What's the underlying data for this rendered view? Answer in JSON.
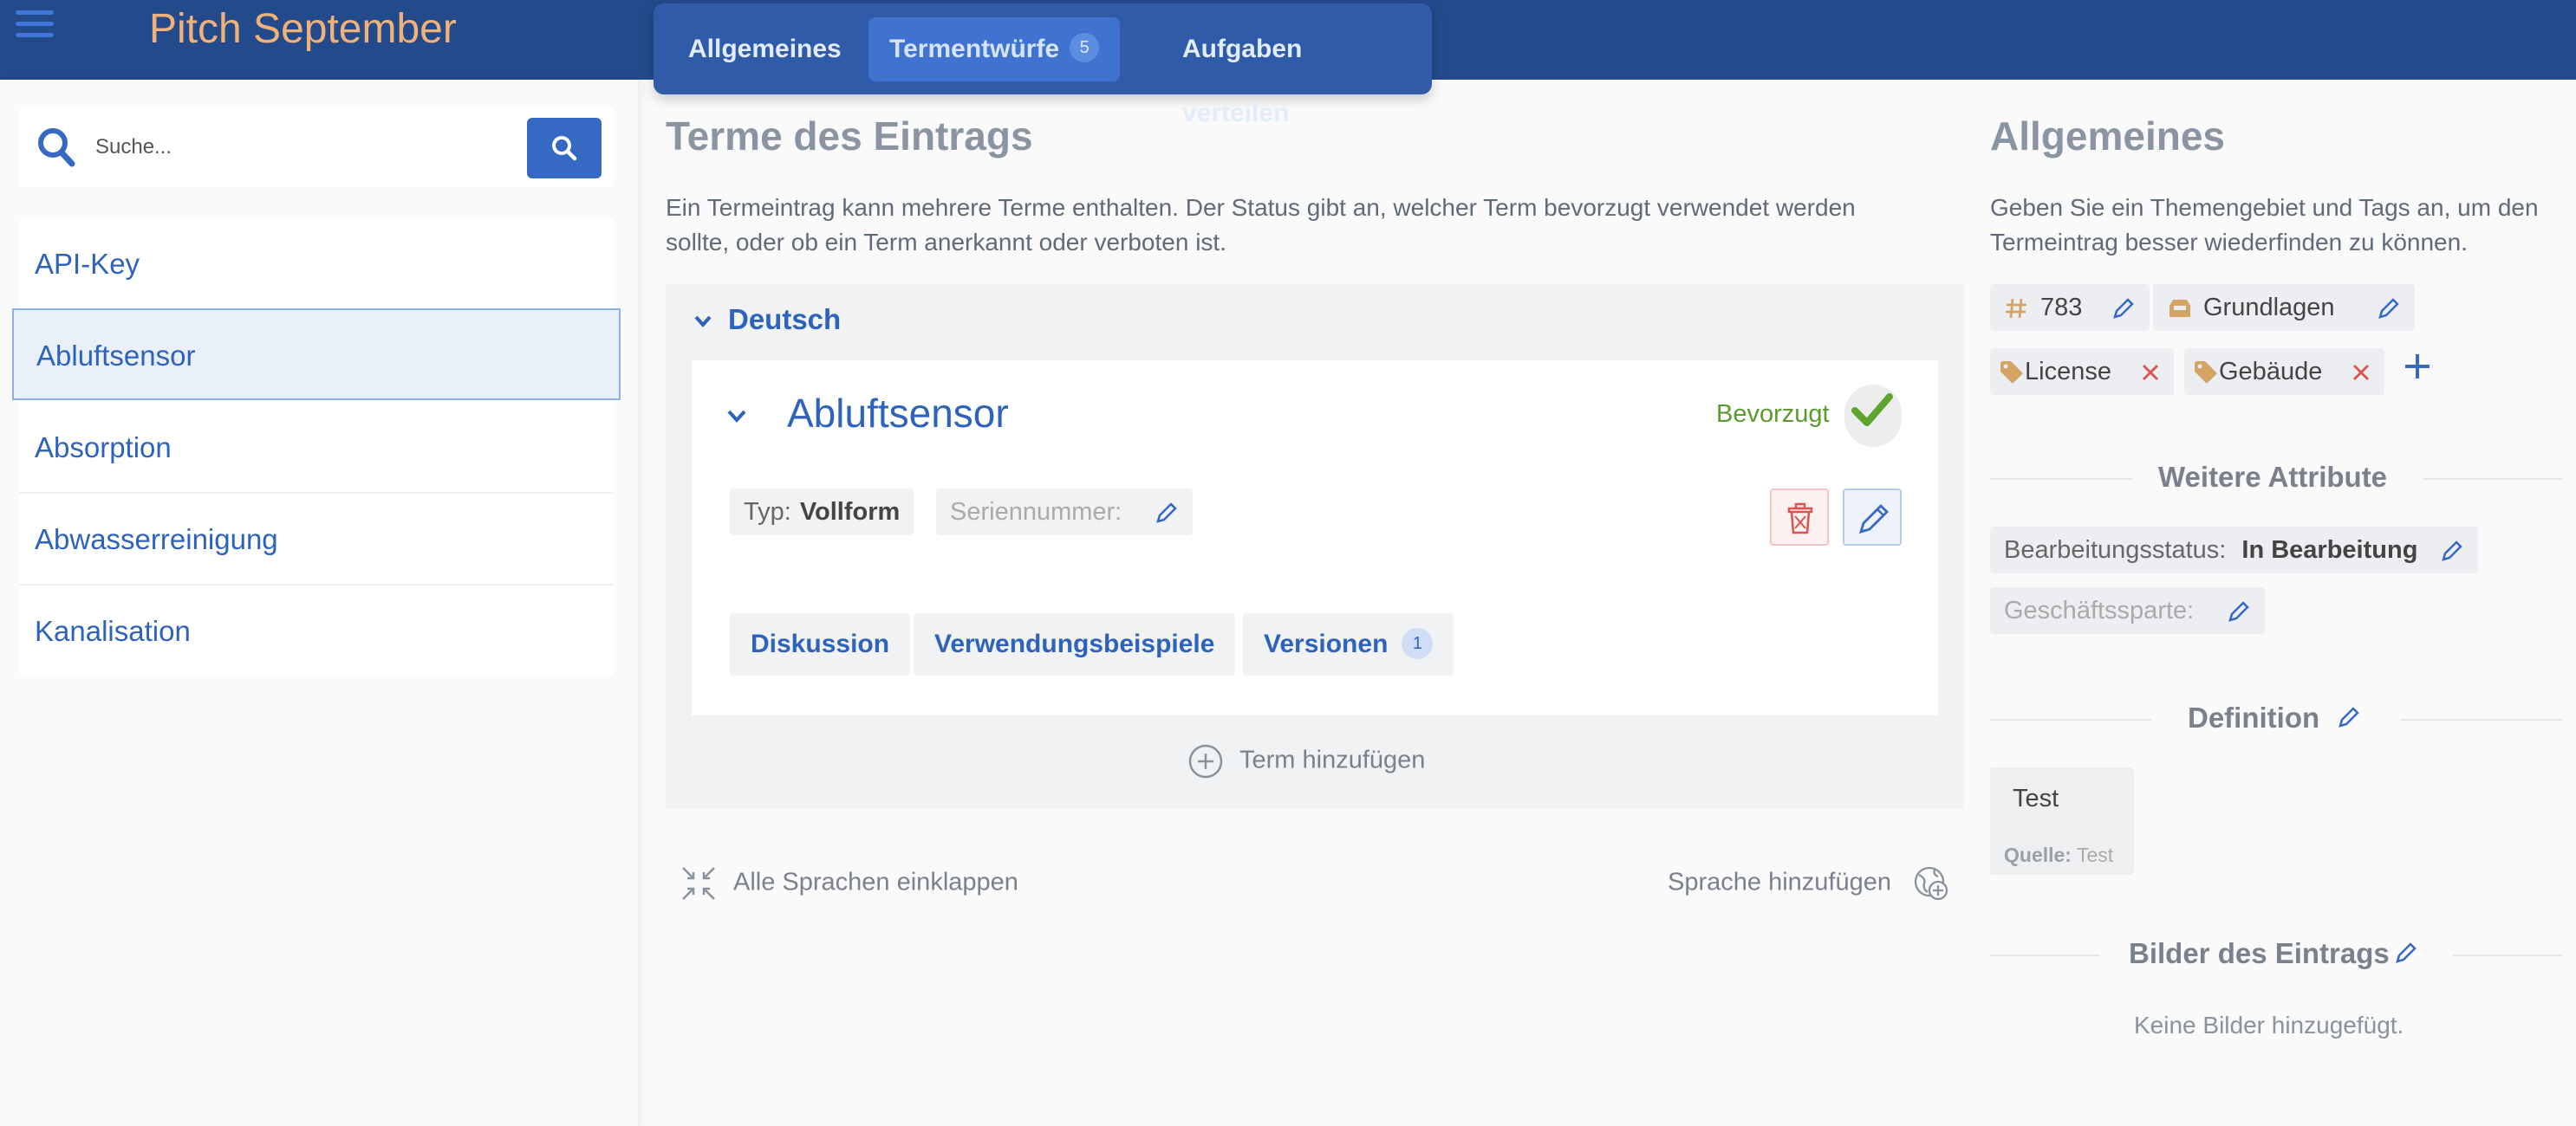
{
  "app": {
    "title": "Pitch September"
  },
  "tabs": [
    {
      "label": "Allgemeines"
    },
    {
      "label": "Termentwürfe",
      "badge": "5"
    },
    {
      "label": "Aufgaben verteilen"
    }
  ],
  "search": {
    "placeholder": "Suche...",
    "value": ""
  },
  "sidebar": {
    "items": [
      {
        "label": "API-Key"
      },
      {
        "label": "Abluftsensor",
        "selected": true
      },
      {
        "label": "Absorption"
      },
      {
        "label": "Abwasserreinigung"
      },
      {
        "label": "Kanalisation"
      }
    ]
  },
  "main": {
    "title": "Terme des Eintrags",
    "description_line1": "Ein Termeintrag kann mehrere Terme enthalten. Der Status gibt an, welcher Term bevorzugt verwendet werden",
    "description_line2": "sollte, oder ob ein Term anerkannt oder verboten ist.",
    "language": "Deutsch",
    "term": {
      "name": "Abluftsensor",
      "status": "Bevorzugt",
      "type_label": "Typ:",
      "type_value": "Vollform",
      "serial_label": "Seriennummer:",
      "subtabs": [
        {
          "label": "Diskussion"
        },
        {
          "label": "Verwendungsbeispiele"
        },
        {
          "label": "Versionen",
          "badge": "1"
        }
      ]
    },
    "add_term": "Term hinzufügen",
    "collapse_all": "Alle Sprachen einklappen",
    "add_language": "Sprache hinzufügen"
  },
  "right": {
    "title": "Allgemeines",
    "description_line1": "Geben Sie ein Themengebiet und Tags an, um den",
    "description_line2": "Termeintrag besser wiederfinden zu können.",
    "id": "783",
    "subject": "Grundlagen",
    "tags": [
      "License",
      "Gebäude"
    ],
    "more_attributes_title": "Weitere Attribute",
    "edit_status_label": "Bearbeitungsstatus:",
    "edit_status_value": "In Bearbeitung",
    "business_label": "Geschäftssparte:",
    "definition_title": "Definition",
    "definition_text": "Test",
    "definition_source_label": "Quelle:",
    "definition_source_value": "Test",
    "images_title": "Bilder des Eintrags",
    "images_empty": "Keine Bilder hinzugefügt."
  },
  "colors": {
    "topbar": "#234a8b",
    "accent": "#3569c4",
    "title_orange": "#f0b27a",
    "preferred_green": "#5a9a2e",
    "delete_red": "#d9534f"
  },
  "icons": {
    "menu": "hamburger-icon",
    "search": "search-icon",
    "check": "check-icon",
    "trash": "trash-icon",
    "edit": "pencil-icon",
    "plus": "plus-icon",
    "tag": "tag-icon",
    "hash": "hash-icon",
    "inbox": "inbox-icon",
    "collapse": "collapse-icon",
    "add_language": "globe-plus-icon"
  }
}
